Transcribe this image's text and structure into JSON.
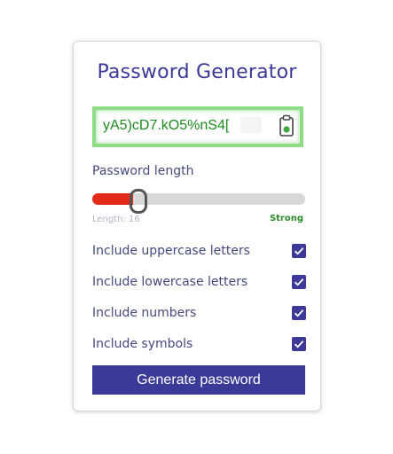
{
  "app": {
    "title": "Password Generator"
  },
  "password": {
    "value": "yA5)cD7.kO5%nS4[",
    "copy_icon": "clipboard-icon"
  },
  "length": {
    "label": "Password length",
    "info": "Length: 16",
    "value": 16,
    "min": 8,
    "max": 64,
    "fill_fraction": 0.19,
    "strength": "Strong"
  },
  "options": [
    {
      "label": "Include uppercase letters",
      "checked": true
    },
    {
      "label": "Include lowercase letters",
      "checked": true
    },
    {
      "label": "Include numbers",
      "checked": true
    },
    {
      "label": "Include symbols",
      "checked": true
    }
  ],
  "generate": {
    "label": "Generate password"
  },
  "colors": {
    "accent": "#3b3a98",
    "password_text": "#1e8a1e",
    "strength_text": "#2c8a2c",
    "slider_fill": "#e32b1a",
    "box_border": "#8edc86"
  }
}
